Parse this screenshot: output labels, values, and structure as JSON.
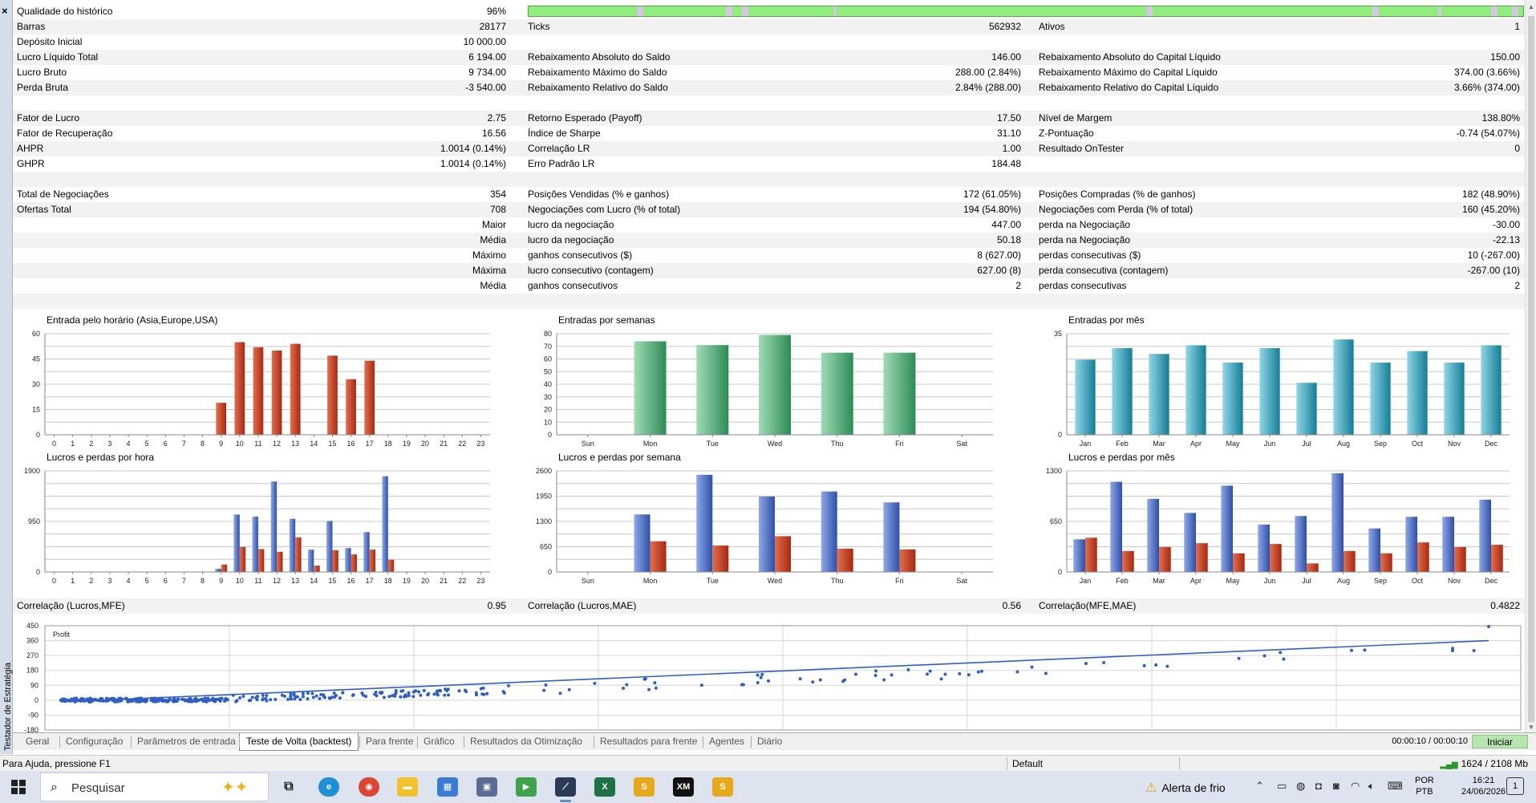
{
  "window": {
    "side_title": "Testador de Estratégia",
    "close_label": "×"
  },
  "stats": {
    "rows": [
      {
        "l1": "Qualidade do histórico",
        "v1": "96%",
        "l2": "",
        "v2": "",
        "l3": "",
        "v3": "",
        "bar": true
      },
      {
        "l1": "Barras",
        "v1": "28177",
        "l2": "Ticks",
        "v2": "562932",
        "l3": "Ativos",
        "v3": "1"
      },
      {
        "l1": "Depósito Inicial",
        "v1": "10 000.00",
        "l2": "",
        "v2": "",
        "l3": "",
        "v3": ""
      },
      {
        "l1": "Lucro Líquido Total",
        "v1": "6 194.00",
        "l2": "Rebaixamento Absoluto do Saldo",
        "v2": "146.00",
        "l3": "Rebaixamento Absoluto do Capital Líquido",
        "v3": "150.00"
      },
      {
        "l1": "Lucro Bruto",
        "v1": "9 734.00",
        "l2": "Rebaixamento Máximo do Saldo",
        "v2": "288.00 (2.84%)",
        "l3": "Rebaixamento Máximo do Capital Líquido",
        "v3": "374.00 (3.66%)"
      },
      {
        "l1": "Perda Bruta",
        "v1": "-3 540.00",
        "l2": "Rebaixamento Relativo do Saldo",
        "v2": "2.84% (288.00)",
        "l3": "Rebaixamento Relativo do Capital Líquido",
        "v3": "3.66% (374.00)"
      },
      {
        "l1": "",
        "v1": "",
        "l2": "",
        "v2": "",
        "l3": "",
        "v3": ""
      },
      {
        "l1": "Fator de Lucro",
        "v1": "2.75",
        "l2": "Retorno Esperado (Payoff)",
        "v2": "17.50",
        "l3": "Nível de Margem",
        "v3": "138.80%"
      },
      {
        "l1": "Fator de Recuperação",
        "v1": "16.56",
        "l2": "Índice de Sharpe",
        "v2": "31.10",
        "l3": "Z-Pontuação",
        "v3": "-0.74 (54.07%)"
      },
      {
        "l1": "AHPR",
        "v1": "1.0014 (0.14%)",
        "l2": "Correlação LR",
        "v2": "1.00",
        "l3": "Resultado OnTester",
        "v3": "0"
      },
      {
        "l1": "GHPR",
        "v1": "1.0014 (0.14%)",
        "l2": "Erro Padrão LR",
        "v2": "184.48",
        "l3": "",
        "v3": ""
      },
      {
        "l1": "",
        "v1": "",
        "l2": "",
        "v2": "",
        "l3": "",
        "v3": ""
      },
      {
        "l1": "Total de Negociações",
        "v1": "354",
        "l2": "Posições Vendidas (% e ganhos)",
        "v2": "172 (61.05%)",
        "l3": "Posições Compradas (% de ganhos)",
        "v3": "182 (48.90%)"
      },
      {
        "l1": "Ofertas Total",
        "v1": "708",
        "l2": "Negociações com Lucro (% of total)",
        "v2": "194 (54.80%)",
        "l3": "Negociações com Perda (% of total)",
        "v3": "160 (45.20%)"
      },
      {
        "l1": "",
        "v1": "Maior",
        "l2": "lucro da negociação",
        "v2": "447.00",
        "l3": "perda na Negociação",
        "v3": "-30.00"
      },
      {
        "l1": "",
        "v1": "Média",
        "l2": "lucro da negociação",
        "v2": "50.18",
        "l3": "perda na Negociação",
        "v3": "-22.13"
      },
      {
        "l1": "",
        "v1": "Máximo",
        "l2": "ganhos consecutivos ($)",
        "v2": "8 (627.00)",
        "l3": "perdas consecutivas ($)",
        "v3": "10 (-267.00)"
      },
      {
        "l1": "",
        "v1": "Máxima",
        "l2": "lucro consecutivo (contagem)",
        "v2": "627.00 (8)",
        "l3": "perda consecutiva (contagem)",
        "v3": "-267.00 (10)"
      },
      {
        "l1": "",
        "v1": "Média",
        "l2": "ganhos consecutivos",
        "v2": "2",
        "l3": "perdas consecutivas",
        "v3": "2"
      }
    ],
    "correlation": {
      "l1": "Correlação (Lucros,MFE)",
      "v1": "0.95",
      "l2": "Correlação (Lucros,MAE)",
      "v2": "0.56",
      "l3": "Correlação(MFE,MAE)",
      "v3": "0.4822"
    }
  },
  "chart_data": [
    {
      "id": "entries-hour",
      "type": "bar",
      "title": "Entrada pelo horário (Asia,Europe,USA)",
      "categories": [
        "0",
        "1",
        "2",
        "3",
        "4",
        "5",
        "6",
        "7",
        "8",
        "9",
        "10",
        "11",
        "12",
        "13",
        "14",
        "15",
        "16",
        "17",
        "18",
        "19",
        "20",
        "21",
        "22",
        "23"
      ],
      "values": [
        0,
        0,
        0,
        0,
        0,
        0,
        0,
        0,
        0,
        19,
        55,
        52,
        50,
        54,
        0,
        47,
        33,
        44,
        0,
        0,
        0,
        0,
        0,
        0
      ],
      "yticks": [
        "60",
        "45",
        "30",
        "15",
        "0"
      ],
      "ylim": [
        0,
        60
      ],
      "colors": [
        "#e07050",
        "#a82810"
      ]
    },
    {
      "id": "entries-week",
      "type": "bar",
      "title": "Entradas por semanas",
      "categories": [
        "Sun",
        "Mon",
        "Tue",
        "Wed",
        "Thu",
        "Fri",
        "Sat"
      ],
      "values": [
        0,
        74,
        71,
        79,
        65,
        65,
        0
      ],
      "yticks": [
        "80",
        "70",
        "60",
        "50",
        "40",
        "30",
        "20",
        "10",
        "0"
      ],
      "ylim": [
        0,
        80
      ],
      "colors": [
        "#9fdbb6",
        "#2e8b57"
      ]
    },
    {
      "id": "entries-month",
      "type": "bar",
      "title": "Entradas por mês",
      "categories": [
        "Jan",
        "Feb",
        "Mar",
        "Apr",
        "May",
        "Jun",
        "Jul",
        "Aug",
        "Sep",
        "Oct",
        "Nov",
        "Dec"
      ],
      "values": [
        26,
        30,
        28,
        31,
        25,
        30,
        18,
        33,
        25,
        29,
        25,
        31
      ],
      "yticks": [
        "35",
        "0"
      ],
      "ylim": [
        0,
        35
      ],
      "colors": [
        "#8fd6e6",
        "#147d96"
      ]
    },
    {
      "id": "pl-hour",
      "type": "bar",
      "title": "Lucros e perdas por hora",
      "categories": [
        "0",
        "1",
        "2",
        "3",
        "4",
        "5",
        "6",
        "7",
        "8",
        "9",
        "10",
        "11",
        "12",
        "13",
        "14",
        "15",
        "16",
        "17",
        "18",
        "19",
        "20",
        "21",
        "22",
        "23"
      ],
      "series": [
        {
          "values": [
            0,
            0,
            0,
            0,
            0,
            0,
            0,
            0,
            0,
            60,
            1080,
            1040,
            1700,
            1000,
            420,
            960,
            450,
            750,
            1800,
            0,
            0,
            0,
            0,
            0
          ]
        },
        {
          "values": [
            0,
            0,
            0,
            0,
            0,
            0,
            0,
            0,
            0,
            140,
            470,
            430,
            380,
            650,
            120,
            410,
            330,
            420,
            230,
            0,
            0,
            0,
            0,
            0
          ]
        }
      ],
      "yticks": [
        "1900",
        "950",
        "0"
      ],
      "ylim": [
        0,
        1900
      ],
      "colors": [
        "#8fa8e6",
        "#2f4fa8",
        "#e07050",
        "#a82810"
      ]
    },
    {
      "id": "pl-week",
      "type": "bar",
      "title": "Lucros e perdas por semana",
      "categories": [
        "Sun",
        "Mon",
        "Tue",
        "Wed",
        "Thu",
        "Fri",
        "Sat"
      ],
      "series": [
        {
          "values": [
            0,
            1480,
            2500,
            1940,
            2070,
            1790,
            0
          ]
        },
        {
          "values": [
            0,
            790,
            680,
            920,
            600,
            580,
            0
          ]
        }
      ],
      "yticks": [
        "2600",
        "1950",
        "1300",
        "650",
        "0"
      ],
      "ylim": [
        0,
        2600
      ],
      "colors": [
        "#8fa8e6",
        "#2f4fa8",
        "#e07050",
        "#a82810"
      ]
    },
    {
      "id": "pl-month",
      "type": "bar",
      "title": "Lucros e perdas por mês",
      "categories": [
        "Jan",
        "Feb",
        "Mar",
        "Apr",
        "May",
        "Jun",
        "Jul",
        "Aug",
        "Sep",
        "Oct",
        "Nov",
        "Dec"
      ],
      "series": [
        {
          "values": [
            420,
            1160,
            940,
            760,
            1110,
            610,
            720,
            1270,
            560,
            710,
            710,
            930
          ]
        },
        {
          "values": [
            440,
            270,
            320,
            370,
            240,
            360,
            110,
            270,
            240,
            380,
            320,
            350
          ]
        }
      ],
      "yticks": [
        "1300",
        "650",
        "0"
      ],
      "ylim": [
        0,
        1300
      ],
      "colors": [
        "#8fa8e6",
        "#2f4fa8",
        "#e07050",
        "#a82810"
      ]
    },
    {
      "id": "mfe-scatter",
      "type": "scatter",
      "title": "",
      "series": [
        {
          "name": "Profit",
          "x": [],
          "y": []
        }
      ],
      "yticks": [
        "450",
        "360",
        "270",
        "180",
        "90",
        "0",
        "-90",
        "-180"
      ],
      "ylim": [
        -180,
        450
      ],
      "trend": {
        "from": [
          0,
          -10
        ],
        "to": [
          1,
          360
        ]
      },
      "color": "#2f5fc4"
    }
  ],
  "tabs": {
    "items": [
      "Geral",
      "Configuração",
      "Parâmetros de entrada",
      "Teste de Volta (backtest)",
      "Para frente",
      "Gráfico",
      "Resultados da Otimização",
      "Resultados para frente",
      "Agentes",
      "Diário"
    ],
    "active_index": 3,
    "timer": "00:00:10 / 00:00:10",
    "start_label": "Iniciar"
  },
  "statusbar": {
    "help": "Para Ajuda, pressione F1",
    "profile": "Default",
    "memory": "1624 / 2108 Mb"
  },
  "taskbar": {
    "search_placeholder": "Pesquisar",
    "weather_alert": "Alerta de frio",
    "lang_top": "POR",
    "lang_bottom": "PTB",
    "time": "16:21",
    "date": "24/06/2026",
    "notif_count": "1"
  }
}
